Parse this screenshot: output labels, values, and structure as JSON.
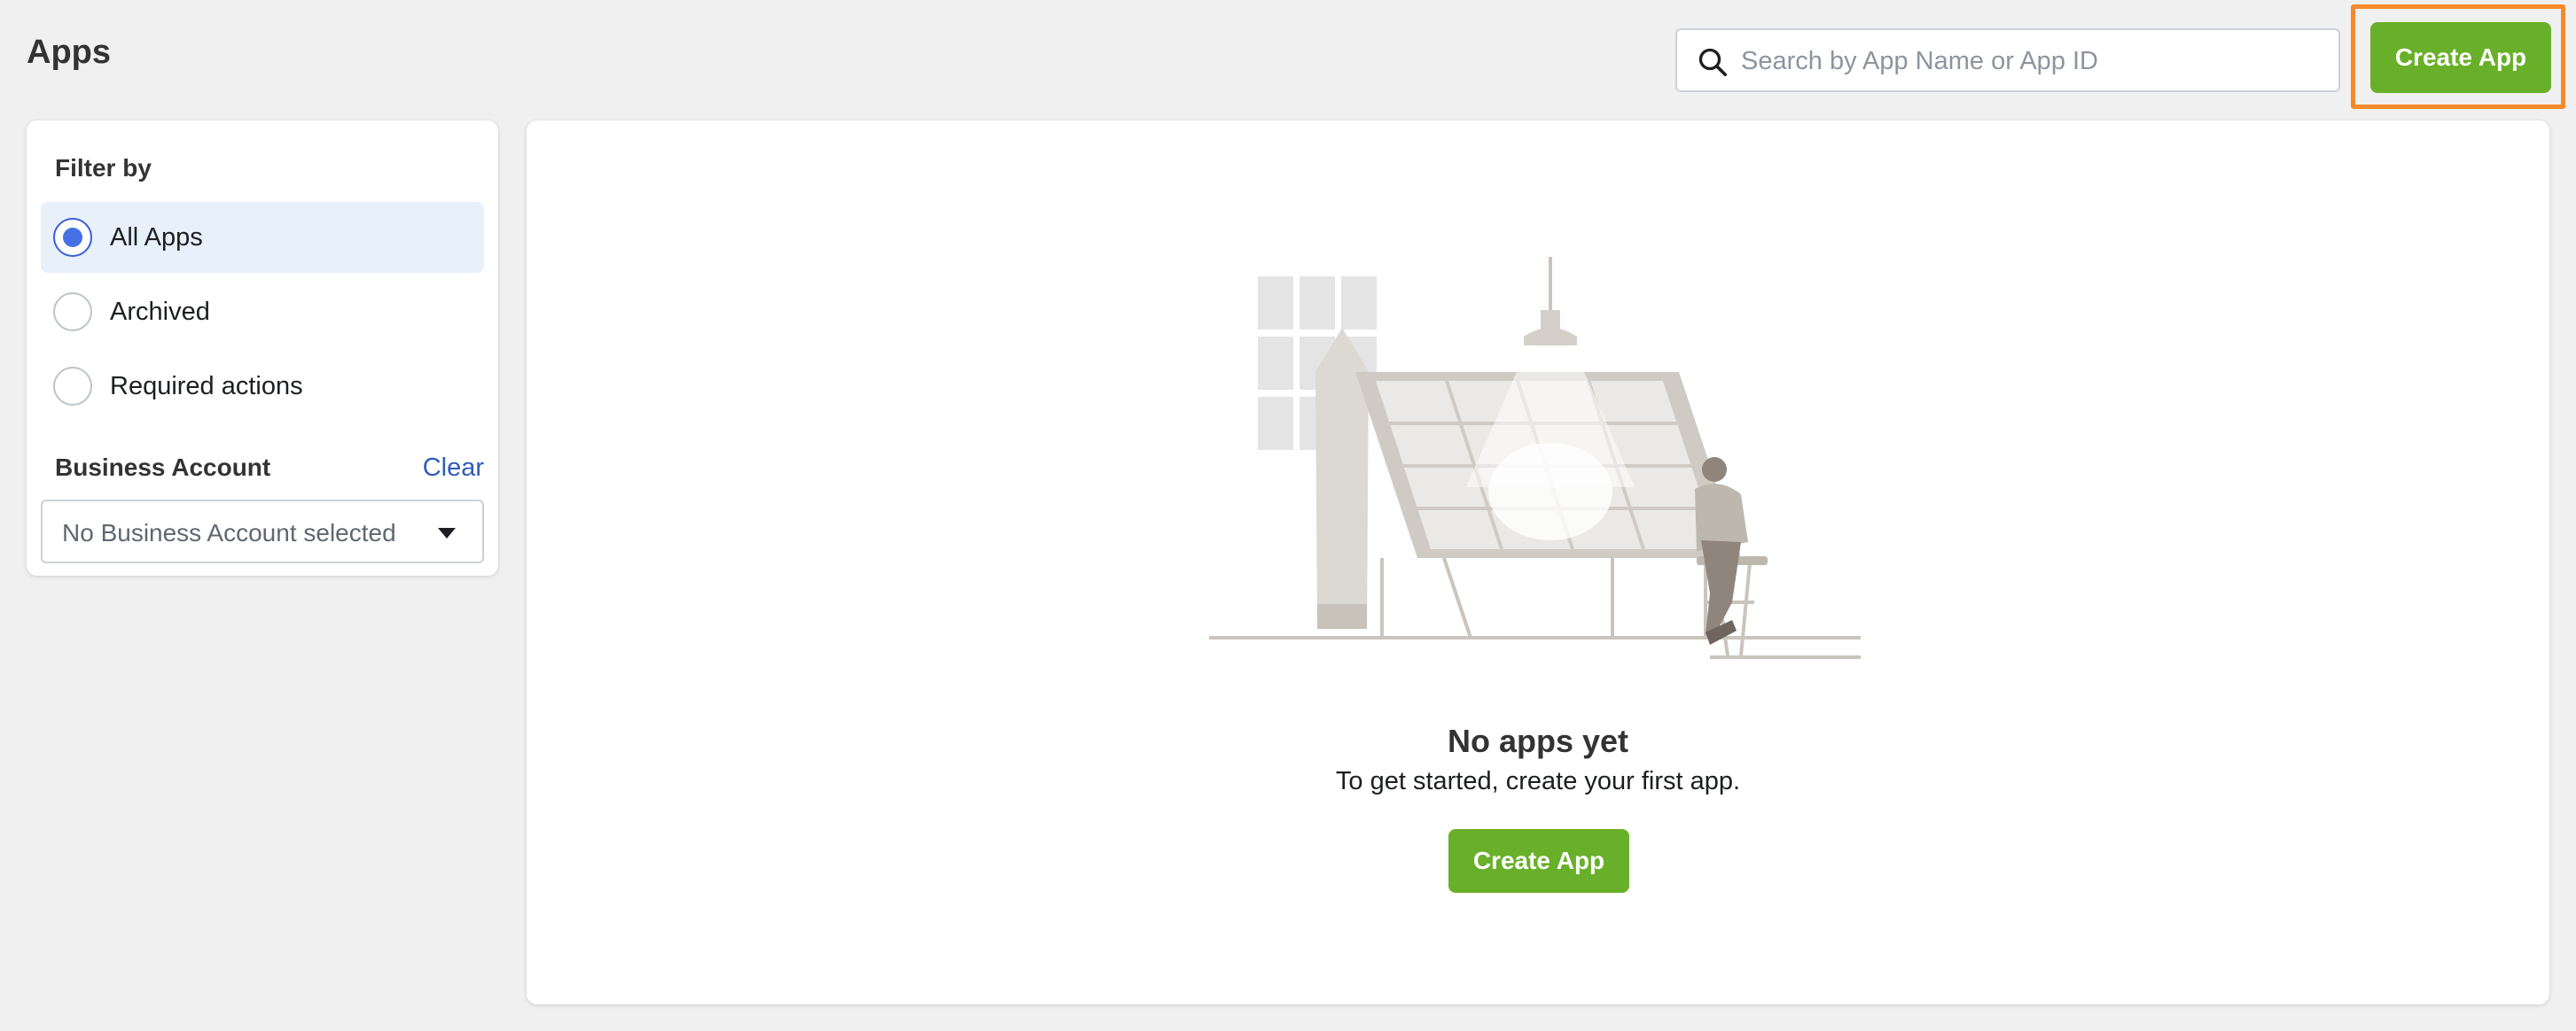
{
  "page": {
    "title": "Apps"
  },
  "search": {
    "placeholder": "Search by App Name or App ID",
    "value": ""
  },
  "header": {
    "create_label": "Create App"
  },
  "filter": {
    "title": "Filter by",
    "options": [
      {
        "label": "All Apps",
        "selected": true
      },
      {
        "label": "Archived",
        "selected": false
      },
      {
        "label": "Required actions",
        "selected": false
      }
    ],
    "business_account": {
      "title": "Business Account",
      "clear_label": "Clear",
      "selected_value": "No Business Account selected"
    }
  },
  "empty_state": {
    "title": "No apps yet",
    "subtitle": "To get started, create your first app.",
    "button_label": "Create App"
  },
  "colors": {
    "accent_green": "#69b02a",
    "highlight_orange": "#f58a2b",
    "radio_blue": "#4671e6",
    "link_blue": "#2e5cb8",
    "selected_bg": "#e7f0fb"
  }
}
